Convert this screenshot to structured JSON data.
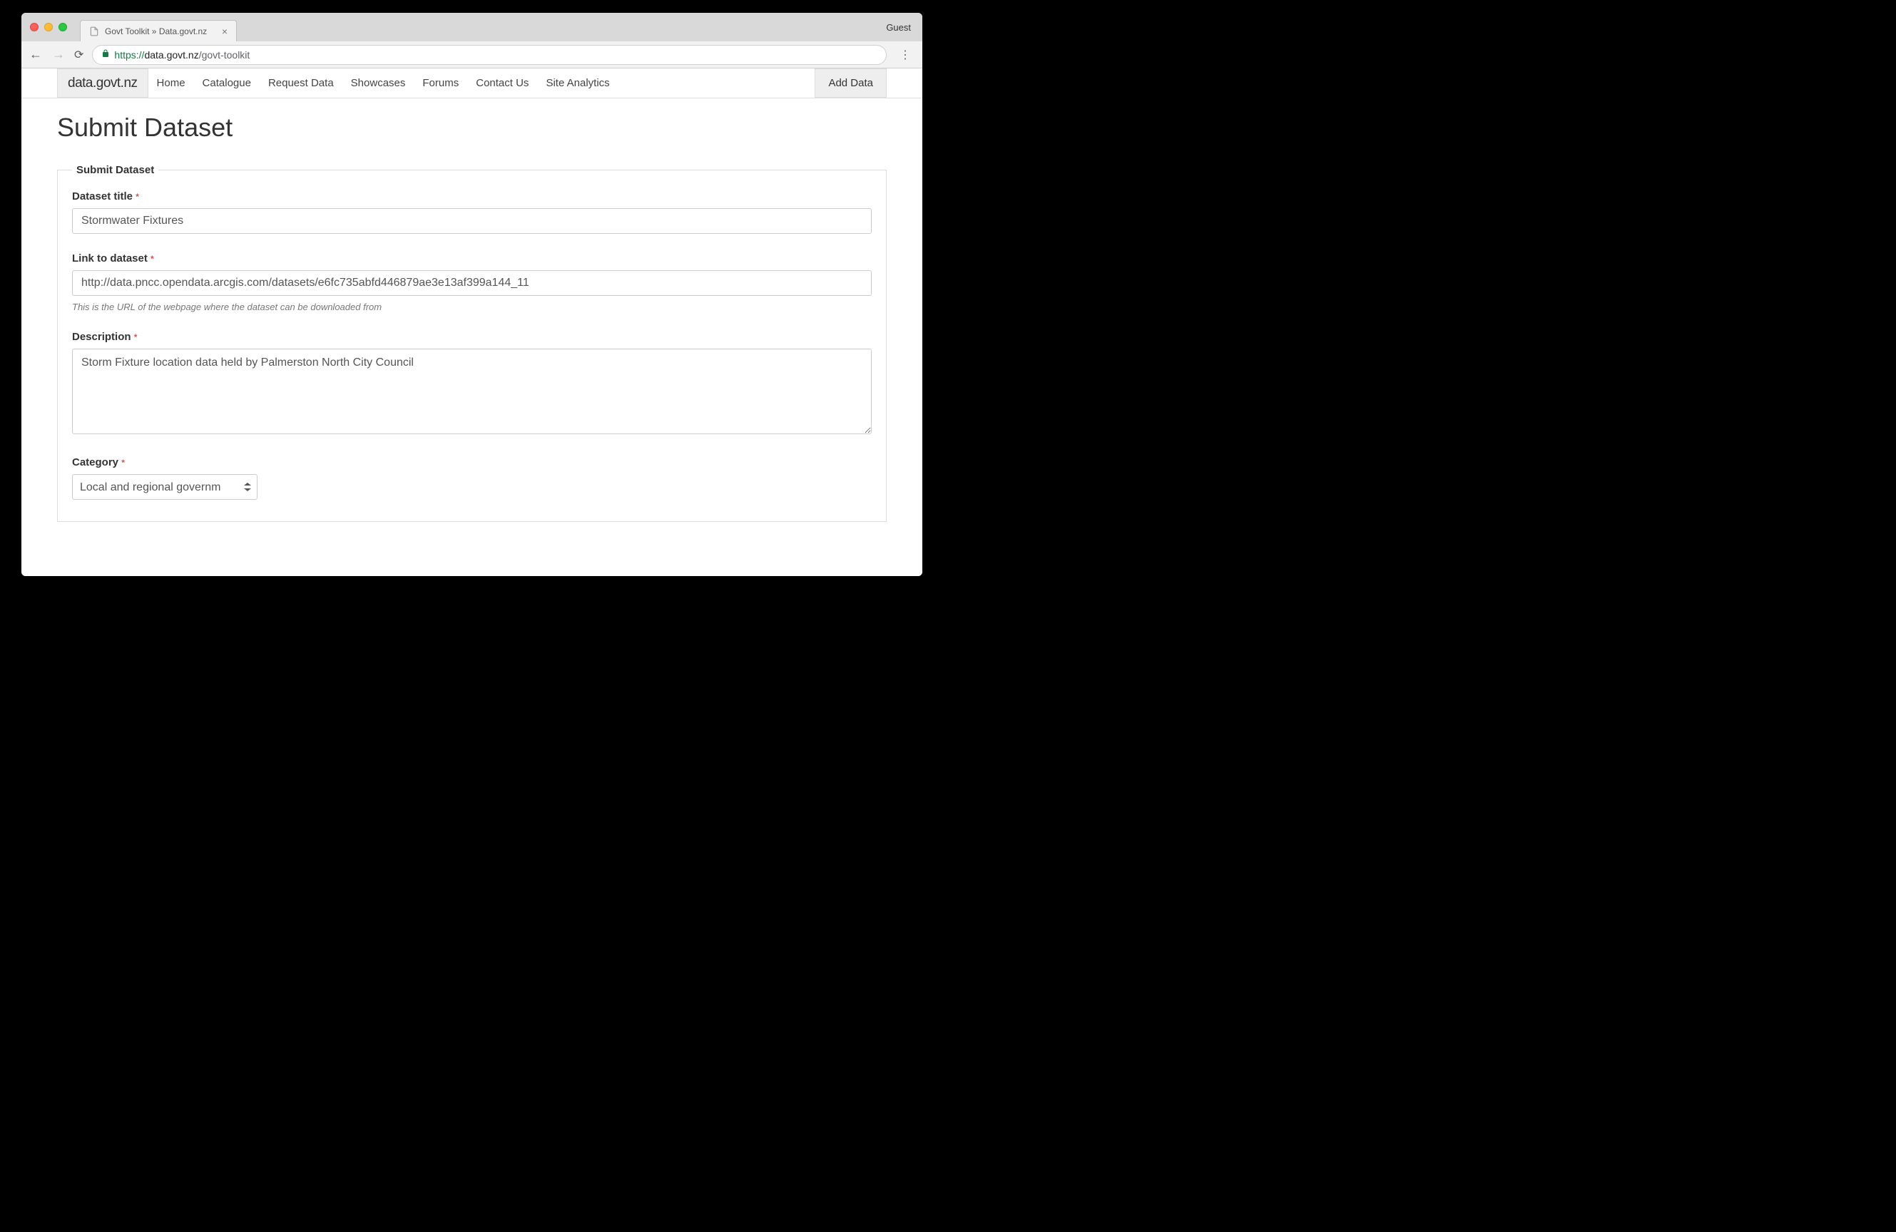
{
  "browser": {
    "tab_title": "Govt Toolkit » Data.govt.nz",
    "guest_label": "Guest",
    "url_protocol": "https://",
    "url_domain": "data.govt.nz",
    "url_path": "/govt-toolkit"
  },
  "nav": {
    "logo": "data.govt.nz",
    "links": [
      "Home",
      "Catalogue",
      "Request Data",
      "Showcases",
      "Forums",
      "Contact Us",
      "Site Analytics"
    ],
    "add_data": "Add Data"
  },
  "page": {
    "title": "Submit Dataset",
    "legend": "Submit Dataset"
  },
  "form": {
    "title_label": "Dataset title",
    "title_value": "Stormwater Fixtures",
    "link_label": "Link to dataset",
    "link_value": "http://data.pncc.opendata.arcgis.com/datasets/e6fc735abfd446879ae3e13af399a144_11",
    "link_help": "This is the URL of the webpage where the dataset can be downloaded from",
    "description_label": "Description",
    "description_value": "Storm Fixture location data held by Palmerston North City Council",
    "category_label": "Category",
    "category_value": "Local and regional governm"
  }
}
